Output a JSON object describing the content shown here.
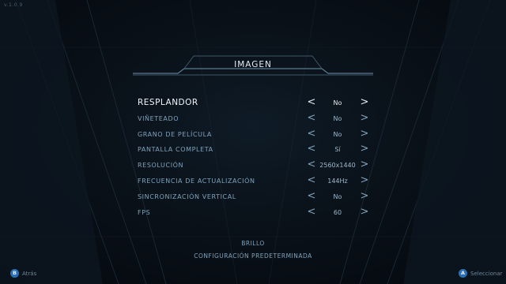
{
  "version": "v.1.0.9",
  "title": "IMAGEN",
  "settings": [
    {
      "label": "RESPLANDOR",
      "value": "No",
      "selected": true
    },
    {
      "label": "VIÑETEADO",
      "value": "No"
    },
    {
      "label": "GRANO DE PELÍCULA",
      "value": "No"
    },
    {
      "label": "PANTALLA COMPLETA",
      "value": "Sí"
    },
    {
      "label": "RESOLUCIÓN",
      "value": "2560x1440"
    },
    {
      "label": "FRECUENCIA DE ACTUALIZACIÓN",
      "value": "144Hz"
    },
    {
      "label": "SINCRONIZACIÓN VERTICAL",
      "value": "No"
    },
    {
      "label": "FPS",
      "value": "60"
    }
  ],
  "arrows": {
    "left": "<",
    "right": ">"
  },
  "bottom": {
    "brightness": "BRILLO",
    "defaults": "CONFIGURACIÓN PREDETERMINADA"
  },
  "prompts": {
    "back": {
      "button": "B",
      "label": "Atrás"
    },
    "select": {
      "button": "A",
      "label": "Seleccionar"
    }
  },
  "colors": {
    "accent": "#e6edf3",
    "text": "#7fa3bd",
    "button": "#2a6fb3"
  }
}
